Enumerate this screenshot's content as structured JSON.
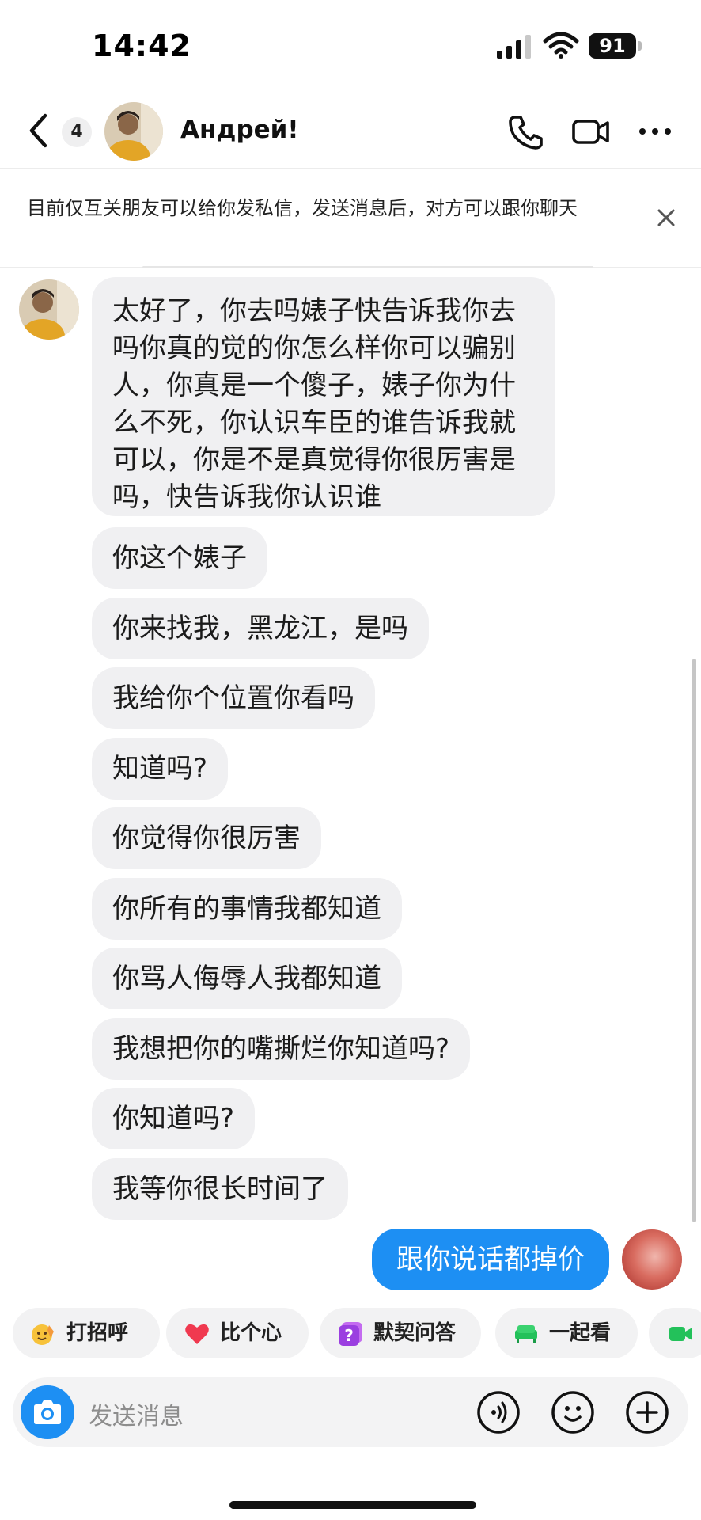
{
  "status": {
    "time": "14:42",
    "battery": "91"
  },
  "header": {
    "unread_count": "4",
    "contact_name": "Андрей!"
  },
  "notice": {
    "text": "目前仅互关朋友可以给你发私信，发送消息后，对方可以跟你聊天"
  },
  "messages": {
    "first_lines": [
      "太好了，你去吗婊子快告诉我你去",
      "吗你真的觉的你怎么样你可以骗别",
      "人，你真是一个傻子，婊子你为什",
      "么不死，你认识车臣的谁告诉我就",
      "可以，你是不是真觉得你很厉害是",
      "吗，快告诉我你认识谁"
    ],
    "incoming": [
      "你这个婊子",
      "你来找我，黑龙江，是吗",
      "我给你个位置你看吗",
      "知道吗?",
      "你觉得你很厉害",
      "你所有的事情我都知道",
      "你骂人侮辱人我都知道",
      "我想把你的嘴撕烂你知道吗?",
      "你知道吗?",
      "我等你很长时间了"
    ],
    "outgoing": "跟你说话都掉价"
  },
  "quick_replies": [
    "打招呼",
    "比个心",
    "默契问答",
    "一起看"
  ],
  "input": {
    "placeholder": "发送消息"
  },
  "colors": {
    "accent": "#1d8ff3",
    "bubble_in": "#f0f0f2"
  }
}
